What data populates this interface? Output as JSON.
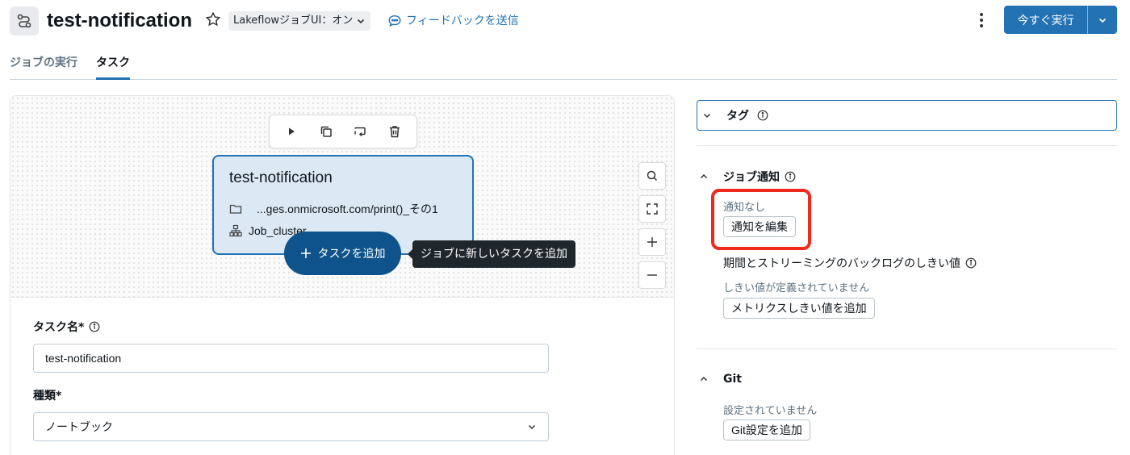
{
  "header": {
    "title": "test-notification",
    "mode_select": "LakeflowジョブUI：オン",
    "feedback": "フィードバックを送信",
    "run_now": "今すぐ実行"
  },
  "tabs": [
    {
      "label": "ジョブの実行"
    },
    {
      "label": "タスク"
    }
  ],
  "canvas": {
    "node": {
      "title": "test-notification",
      "path": "...ges.onmicrosoft.com/print()_その1",
      "cluster": "Job_cluster"
    },
    "add_task": "タスクを追加",
    "tooltip": "ジョブに新しいタスクを追加"
  },
  "form": {
    "task_name_label": "タスク名*",
    "task_name_value": "test-notification",
    "type_label": "種類*",
    "type_value": "ノートブック"
  },
  "right": {
    "tags_title": "タグ",
    "notifications": {
      "title": "ジョブ通知",
      "status": "通知なし",
      "edit_button": "通知を編集",
      "threshold_label": "期間とストリーミングのバックログのしきい値",
      "threshold_status": "しきい値が定義されていません",
      "add_metric_button": "メトリクスしきい値を追加"
    },
    "git": {
      "title": "Git",
      "status": "設定されていません",
      "add_button": "Git設定を追加"
    }
  },
  "colors": {
    "accent": "#2272b4",
    "add_task_bg": "#0e538b",
    "highlight": "#ef2a1c"
  }
}
